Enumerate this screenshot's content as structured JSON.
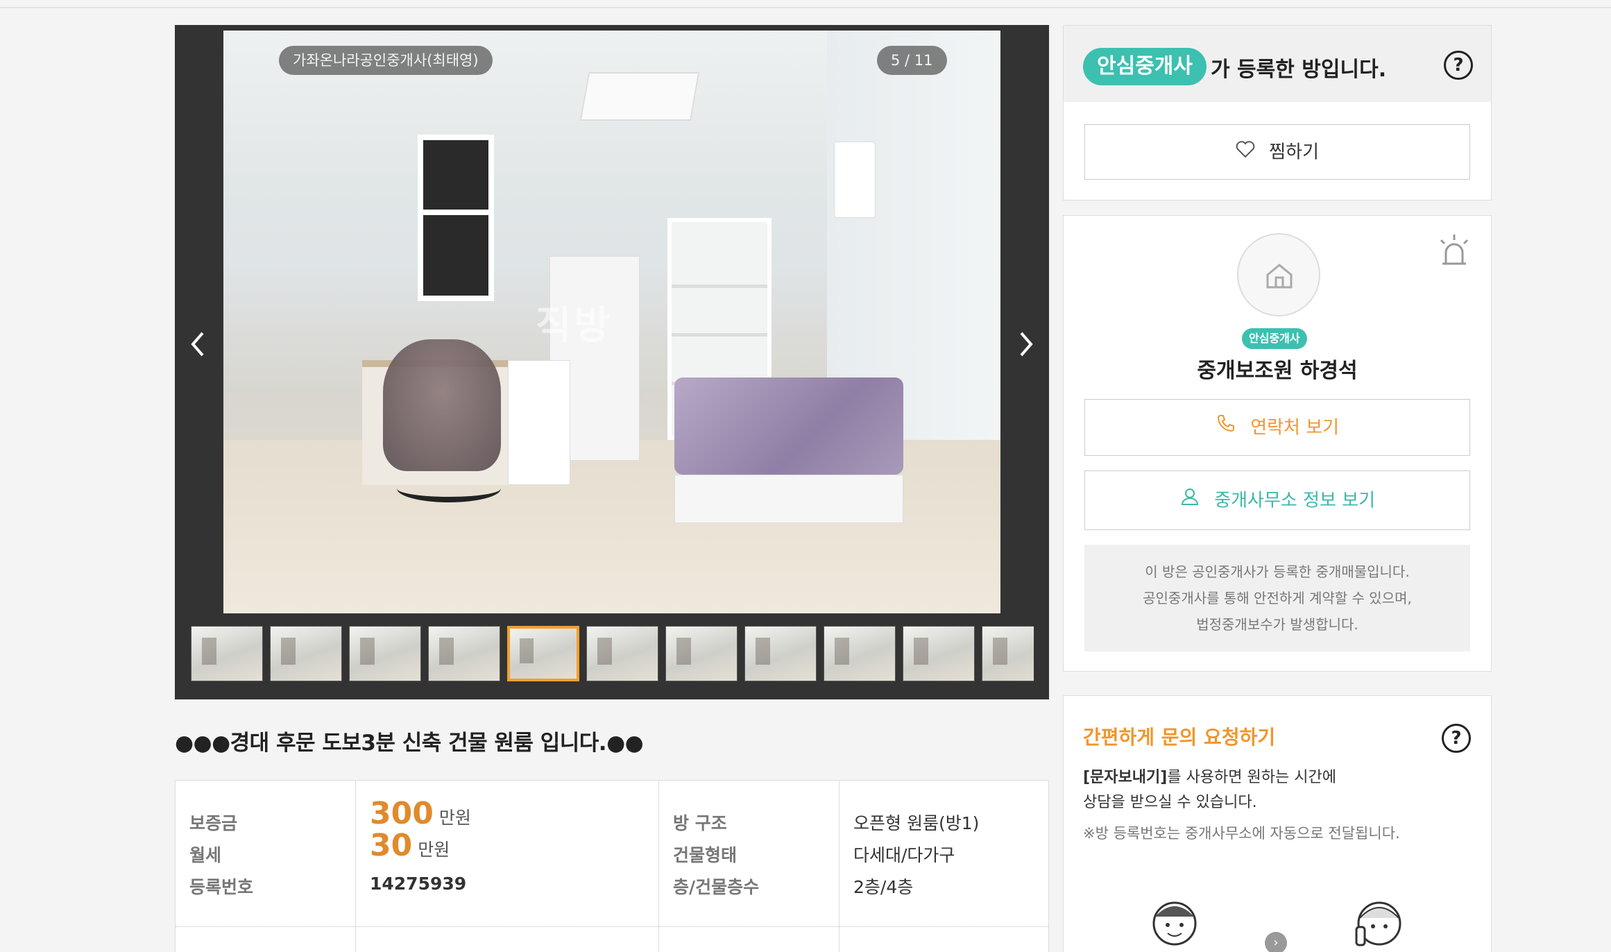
{
  "gallery": {
    "agency_tag": "가좌온나라공인중개사(최태영)",
    "counter": "5 / 11",
    "thumbnail_count": 11,
    "active_index": 5,
    "watermark": "직방"
  },
  "listing": {
    "title": "●●●경대 후문 도보3분 신축 건물 원룸 입니다.●●",
    "deposit_label": "보증금",
    "rent_label": "월세",
    "reg_label": "등록번호",
    "deposit_value": "300",
    "rent_value": "30",
    "price_unit": "만원",
    "reg_number": "14275939",
    "structure_label": "방 구조",
    "building_label": "건물형태",
    "floor_label": "층/건물층수",
    "structure_value": "오픈형 원룸(방1)",
    "building_value": "다세대/다가구",
    "floor_value": "2층/4층"
  },
  "safe_panel": {
    "badge": "안심중개사",
    "headline": "가 등록한 방입니다.",
    "help": "?",
    "zzim_label": "찜하기"
  },
  "agent_panel": {
    "badge": "안심중개사",
    "name": "중개보조원 하경석",
    "contact_label": "연락처 보기",
    "office_label": "중개사무소 정보 보기",
    "notice_lines": [
      "이 방은 공인중개사가 등록한 중개매물입니다.",
      "공인중개사를 통해 안전하게 계약할 수 있으며,",
      "법정중개보수가 발생합니다."
    ]
  },
  "inquiry_panel": {
    "title": "간편하게 문의 요청하기",
    "help": "?",
    "text_bold": "[문자보내기]",
    "text_rest": "를 사용하면 원하는 시간에",
    "text_line2": "상담을 받으실 수 있습니다.",
    "note": "※방 등록번호는 중개사무소에 자동으로 전달됩니다.",
    "step_arrow": "›"
  },
  "colors": {
    "accent_teal": "#3cc0b0",
    "accent_orange": "#f0962d",
    "price_orange": "#e08a2c",
    "active_thumb": "#f0a030"
  }
}
